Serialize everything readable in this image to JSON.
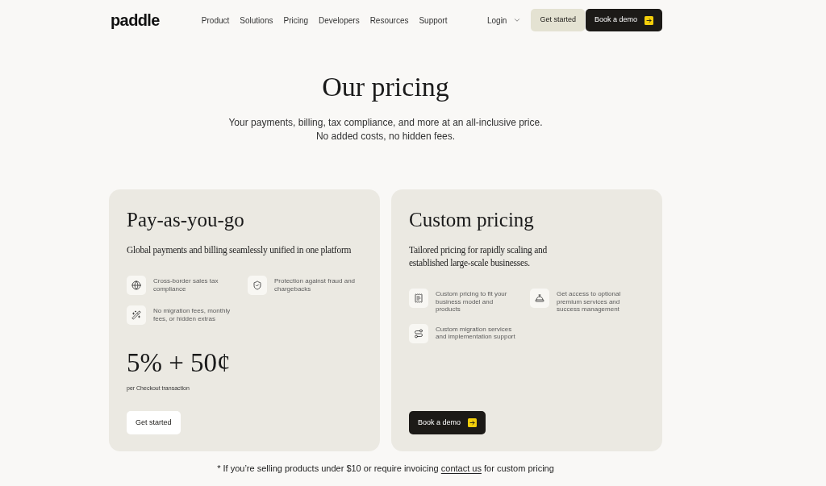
{
  "header": {
    "logo": "paddle",
    "nav": [
      {
        "label": "Product"
      },
      {
        "label": "Solutions"
      },
      {
        "label": "Pricing"
      },
      {
        "label": "Developers"
      },
      {
        "label": "Resources"
      },
      {
        "label": "Support"
      }
    ],
    "login": {
      "label": "Login"
    },
    "buttons": [
      {
        "label": "Get started",
        "kind": "tinted"
      },
      {
        "label": "Book a demo",
        "kind": "dark"
      }
    ]
  },
  "hero": {
    "title": "Our pricing",
    "subtitle": [
      "Your payments, billing, tax compliance, and more at an all-inclusive price.",
      "No added costs, no hidden fees."
    ]
  },
  "plans": [
    {
      "title": "Pay-as-you-go",
      "description": "Global payments and billing seamlessly unified in one platform",
      "features": [
        {
          "text": "Cross-border sales tax compliance"
        },
        {
          "text": "Protection against fraud and chargebacks"
        },
        {
          "text": "No migration fees, monthly fees, or hidden extras"
        }
      ],
      "price": "5% + 50¢",
      "price_note": "per Checkout transaction",
      "button": {
        "label": "Get started",
        "kind": "light"
      }
    },
    {
      "title": "Custom pricing",
      "description": "Tailored pricing for rapidly scaling and established large-scale businesses.",
      "features": [
        {
          "text": "Custom pricing to fit your business model and products"
        },
        {
          "text": "Get access to optional premium services and success management"
        },
        {
          "text": "Custom migration services and implementation support"
        }
      ],
      "button": {
        "label": "Book a demo",
        "kind": "dark"
      }
    }
  ],
  "footnote": {
    "text": "* If you’re selling products under $10 or require invoicing",
    "link": "contact us",
    "text_after": "for custom pricing"
  }
}
